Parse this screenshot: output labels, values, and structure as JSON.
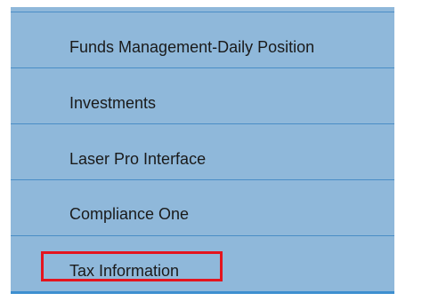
{
  "menu": {
    "items": [
      {
        "label": "Funds Management-Daily Position"
      },
      {
        "label": "Investments"
      },
      {
        "label": "Laser Pro Interface"
      },
      {
        "label": "Compliance One"
      },
      {
        "label": "Tax Information",
        "highlighted": true
      }
    ]
  },
  "colors": {
    "menu_background": "#8fb8da",
    "divider": "#4a8dc6",
    "highlight_border": "#e4141e",
    "text": "#1a1a1a"
  }
}
